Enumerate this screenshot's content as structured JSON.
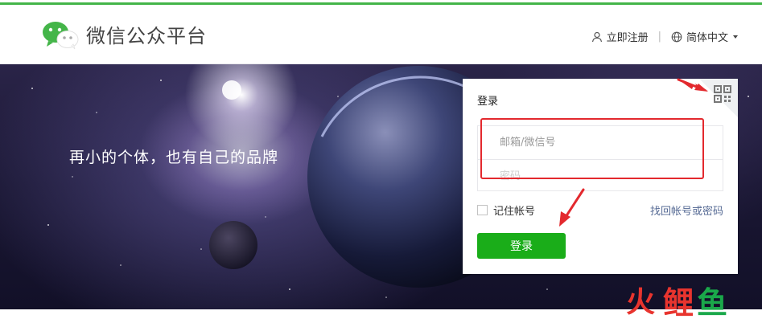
{
  "header": {
    "site_title": "微信公众平台",
    "register_label": "立即注册",
    "separator": "|",
    "language_label": "简体中文"
  },
  "banner": {
    "slogan": "再小的个体，也有自己的品牌"
  },
  "login": {
    "title": "登录",
    "account_placeholder": "邮箱/微信号",
    "password_placeholder": "密码",
    "remember_label": "记住帐号",
    "forgot_label": "找回帐号或密码",
    "submit_label": "登录"
  },
  "watermark": {
    "char1": "火",
    "char2": "鲤",
    "char3": "鱼"
  },
  "colors": {
    "brand_green": "#44b549",
    "button_green": "#1aad19",
    "link_blue": "#576b95",
    "annotation_red": "#e3292e"
  },
  "icons": [
    "wechat-logo-icon",
    "user-icon",
    "globe-icon",
    "qr-code-icon",
    "chevron-down-icon"
  ]
}
